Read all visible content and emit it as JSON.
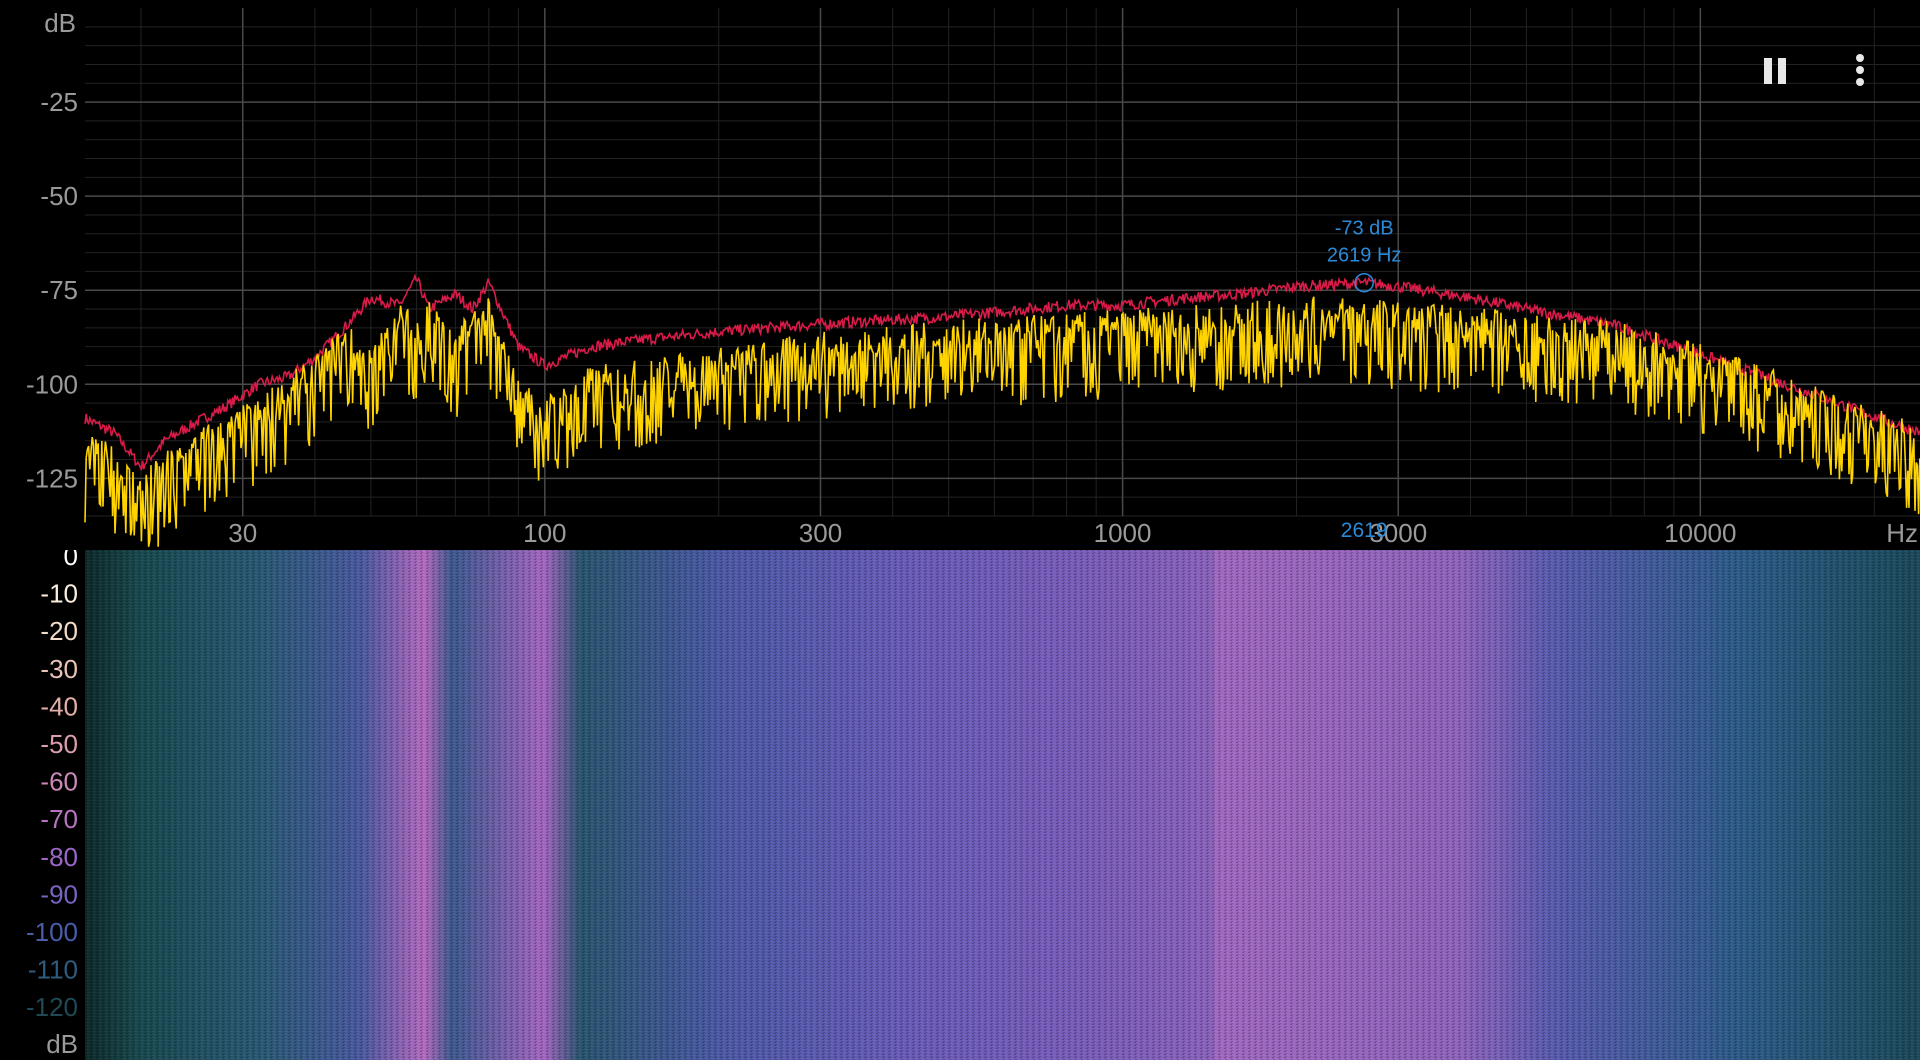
{
  "spectrum": {
    "db_unit": "dB",
    "hz_unit": "Hz",
    "y_ticks": [
      {
        "value": -25,
        "label": "-25"
      },
      {
        "value": -50,
        "label": "-50"
      },
      {
        "value": -75,
        "label": "-75"
      },
      {
        "value": -100,
        "label": "-100"
      },
      {
        "value": -125,
        "label": "-125"
      }
    ],
    "x_ticks": [
      {
        "value": 30,
        "label": "30"
      },
      {
        "value": 100,
        "label": "100"
      },
      {
        "value": 300,
        "label": "300"
      },
      {
        "value": 1000,
        "label": "1000"
      },
      {
        "value": 3000,
        "label": "3000"
      },
      {
        "value": 10000,
        "label": "10000"
      }
    ],
    "x_range": [
      16,
      24000
    ],
    "y_range": [
      -135,
      0
    ],
    "marker": {
      "db_label": "-73 dB",
      "hz_label": "2619 Hz",
      "axis_label": "2619",
      "freq": 2619,
      "db": -73
    },
    "colors": {
      "peak": "#d81b48",
      "current": "#ffd400",
      "marker": "#2a8ad8",
      "grid_major": "#4a4a4a",
      "grid_minor": "#232323",
      "axis_text": "#9a9a9a"
    }
  },
  "chart_data": {
    "type": "line",
    "xscale": "log",
    "xlabel": "Hz",
    "ylabel": "dB",
    "xlim": [
      16,
      24000
    ],
    "ylim": [
      -135,
      0
    ],
    "series": [
      {
        "x": [
          16,
          18,
          20,
          22,
          25,
          28,
          32,
          36,
          40,
          45,
          50,
          56,
          60,
          63,
          70,
          75,
          80,
          90,
          100,
          120,
          150,
          200,
          300,
          500,
          800,
          1000,
          1300,
          1600,
          2000,
          2619,
          3000,
          4000,
          5000,
          7000,
          10000,
          14000,
          18000,
          24000
        ],
        "y": [
          -109,
          -113,
          -122,
          -115,
          -110,
          -106,
          -100,
          -98,
          -93,
          -85,
          -77,
          -79,
          -72,
          -80,
          -76,
          -80,
          -73,
          -90,
          -95,
          -90,
          -88,
          -86,
          -84,
          -82,
          -79,
          -79,
          -77,
          -76,
          -74,
          -73,
          -74,
          -77,
          -80,
          -84,
          -92,
          -100,
          -106,
          -113
        ]
      },
      {
        "x": [
          16,
          18,
          20,
          22,
          25,
          28,
          32,
          36,
          40,
          45,
          50,
          56,
          60,
          63,
          70,
          75,
          80,
          90,
          100,
          120,
          150,
          200,
          300,
          500,
          800,
          1000,
          1300,
          1600,
          2000,
          2619,
          3000,
          4000,
          5000,
          7000,
          10000,
          14000,
          18000,
          24000
        ],
        "y": [
          -120,
          -123,
          -130,
          -125,
          -118,
          -115,
          -110,
          -104,
          -100,
          -90,
          -97,
          -85,
          -88,
          -82,
          -94,
          -85,
          -84,
          -105,
          -110,
          -102,
          -100,
          -97,
          -93,
          -90,
          -88,
          -87,
          -86,
          -85,
          -84,
          -83,
          -85,
          -86,
          -88,
          -90,
          -96,
          -104,
          -110,
          -118
        ]
      }
    ]
  },
  "spectrogram": {
    "db_unit": "dB",
    "scale": [
      {
        "value": 0,
        "label": "0",
        "color": "#ffffff"
      },
      {
        "value": -10,
        "label": "-10",
        "color": "#fbeede"
      },
      {
        "value": -20,
        "label": "-20",
        "color": "#f3dcc6"
      },
      {
        "value": -30,
        "label": "-30",
        "color": "#e8c4b4"
      },
      {
        "value": -40,
        "label": "-40",
        "color": "#e4afaa"
      },
      {
        "value": -50,
        "label": "-50",
        "color": "#db9eae"
      },
      {
        "value": -60,
        "label": "-60",
        "color": "#cc88b8"
      },
      {
        "value": -70,
        "label": "-70",
        "color": "#b874c2"
      },
      {
        "value": -80,
        "label": "-80",
        "color": "#9b68c8"
      },
      {
        "value": -90,
        "label": "-90",
        "color": "#7a62c0"
      },
      {
        "value": -100,
        "label": "-100",
        "color": "#4a5da8"
      },
      {
        "value": -110,
        "label": "-110",
        "color": "#2e5c7e"
      },
      {
        "value": -120,
        "label": "-120",
        "color": "#1f4a55"
      }
    ]
  },
  "controls": {
    "pause_icon": "pause-icon",
    "more_icon": "more-vert-icon"
  }
}
